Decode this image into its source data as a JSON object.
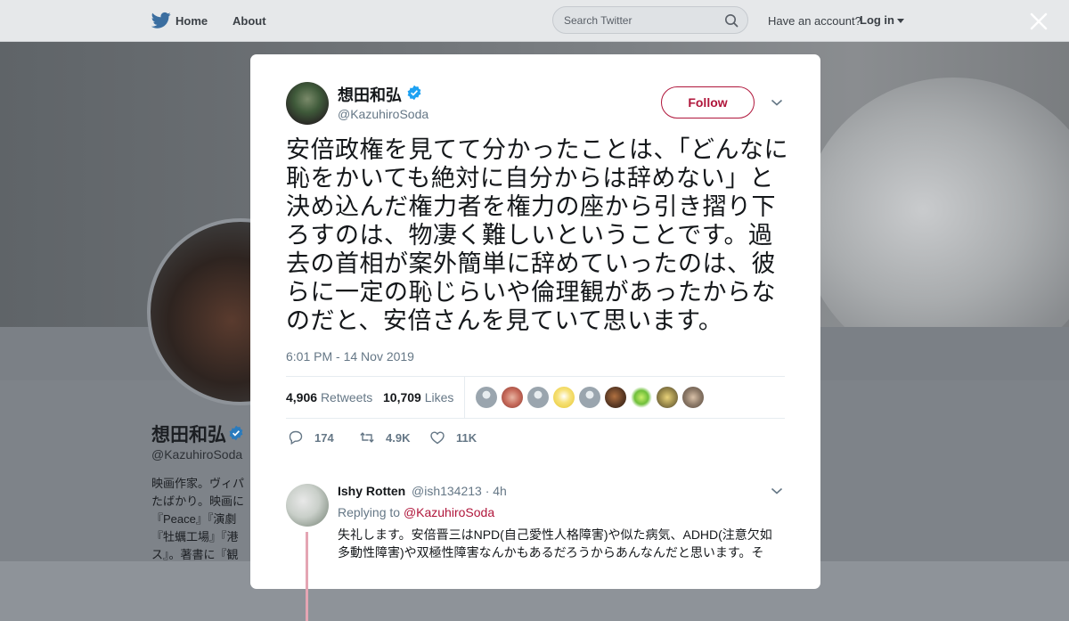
{
  "nav": {
    "home_label": "Home",
    "about_label": "About",
    "search_placeholder": "Search Twitter",
    "have_account": "Have an account?",
    "login_label": "Log in"
  },
  "background_profile": {
    "name": "想田和弘",
    "handle": "@KazuhiroSoda",
    "bio_visible": "映画作家。ヴィパ\nたばかり。映画に\n『Peace』『演劇\n『牡蠣工場』『港\nス』。著書に『観"
  },
  "tweet": {
    "author_name": "想田和弘",
    "author_handle": "@KazuhiroSoda",
    "follow_label": "Follow",
    "text": "安倍政権を見てて分かったことは、「どんなに恥をかいても絶対に自分からは辞めない」と決め込んだ権力者を権力の座から引き摺り下ろすのは、物凄く難しいということです。過去の首相が案外簡単に辞めていったのは、彼らに一定の恥じらいや倫理観があったからなのだと、安倍さんを見ていて思います。",
    "timestamp": "6:01 PM - 14 Nov 2019",
    "retweets_count": "4,906",
    "retweets_label": "Retweets",
    "likes_count": "10,709",
    "likes_label": "Likes",
    "reply_action_count": "174",
    "retweet_action_count": "4.9K",
    "like_action_count": "11K"
  },
  "reply": {
    "name": "Ishy Rotten",
    "meta": "@ish134213 · 4h",
    "replying_prefix": "Replying to",
    "replying_to": "@KazuhiroSoda",
    "text": "失礼します。安倍晋三はNPD(自己愛性人格障害)や似た病気、ADHD(注意欠如多動性障害)や双極性障害なんかもあるだろうからあんなんだと思います。そ"
  },
  "colors": {
    "accent": "#b0163b",
    "verified": "#1da1f2",
    "muted_text": "#657786",
    "overlay": "#8e9399"
  },
  "icons": [
    "twitter-bird-icon",
    "search-icon",
    "caret-down-icon",
    "close-icon",
    "verified-icon",
    "chevron-down-icon",
    "reply-icon",
    "retweet-icon",
    "heart-icon"
  ]
}
